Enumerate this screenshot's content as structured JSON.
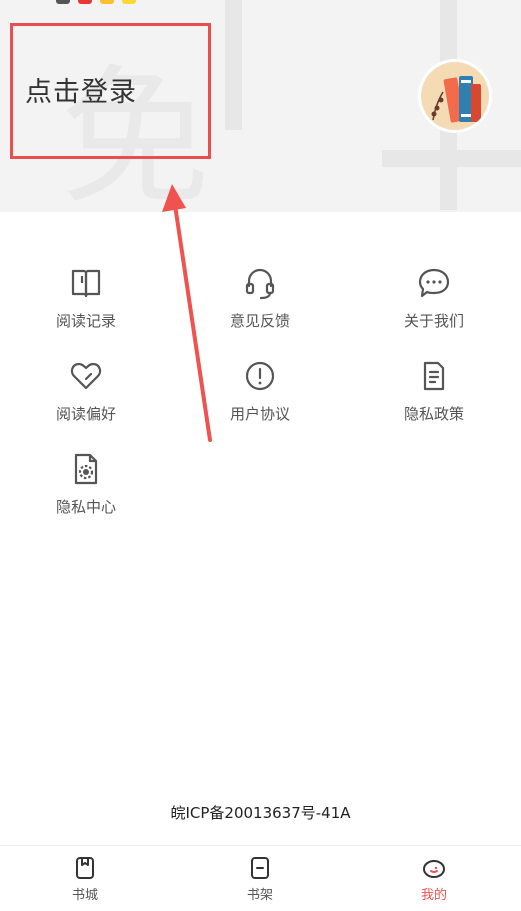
{
  "header": {
    "login_label": "点击登录"
  },
  "menu": {
    "items": [
      {
        "label": "阅读记录",
        "icon": "book-open-icon"
      },
      {
        "label": "意见反馈",
        "icon": "headset-icon"
      },
      {
        "label": "关于我们",
        "icon": "chat-bubble-icon"
      },
      {
        "label": "阅读偏好",
        "icon": "heart-icon"
      },
      {
        "label": "用户协议",
        "icon": "info-circle-icon"
      },
      {
        "label": "隐私政策",
        "icon": "document-icon"
      },
      {
        "label": "隐私中心",
        "icon": "file-gear-icon"
      }
    ]
  },
  "footer": {
    "icp": "皖ICP备20013637号-41A"
  },
  "tabs": [
    {
      "label": "书城",
      "icon": "bookstore-icon",
      "active": false
    },
    {
      "label": "书架",
      "icon": "bookshelf-icon",
      "active": false
    },
    {
      "label": "我的",
      "icon": "profile-icon",
      "active": true
    }
  ],
  "colors": {
    "accent": "#ef5350",
    "highlight": "#e94f4f",
    "header_bg": "#f3f3f3"
  }
}
